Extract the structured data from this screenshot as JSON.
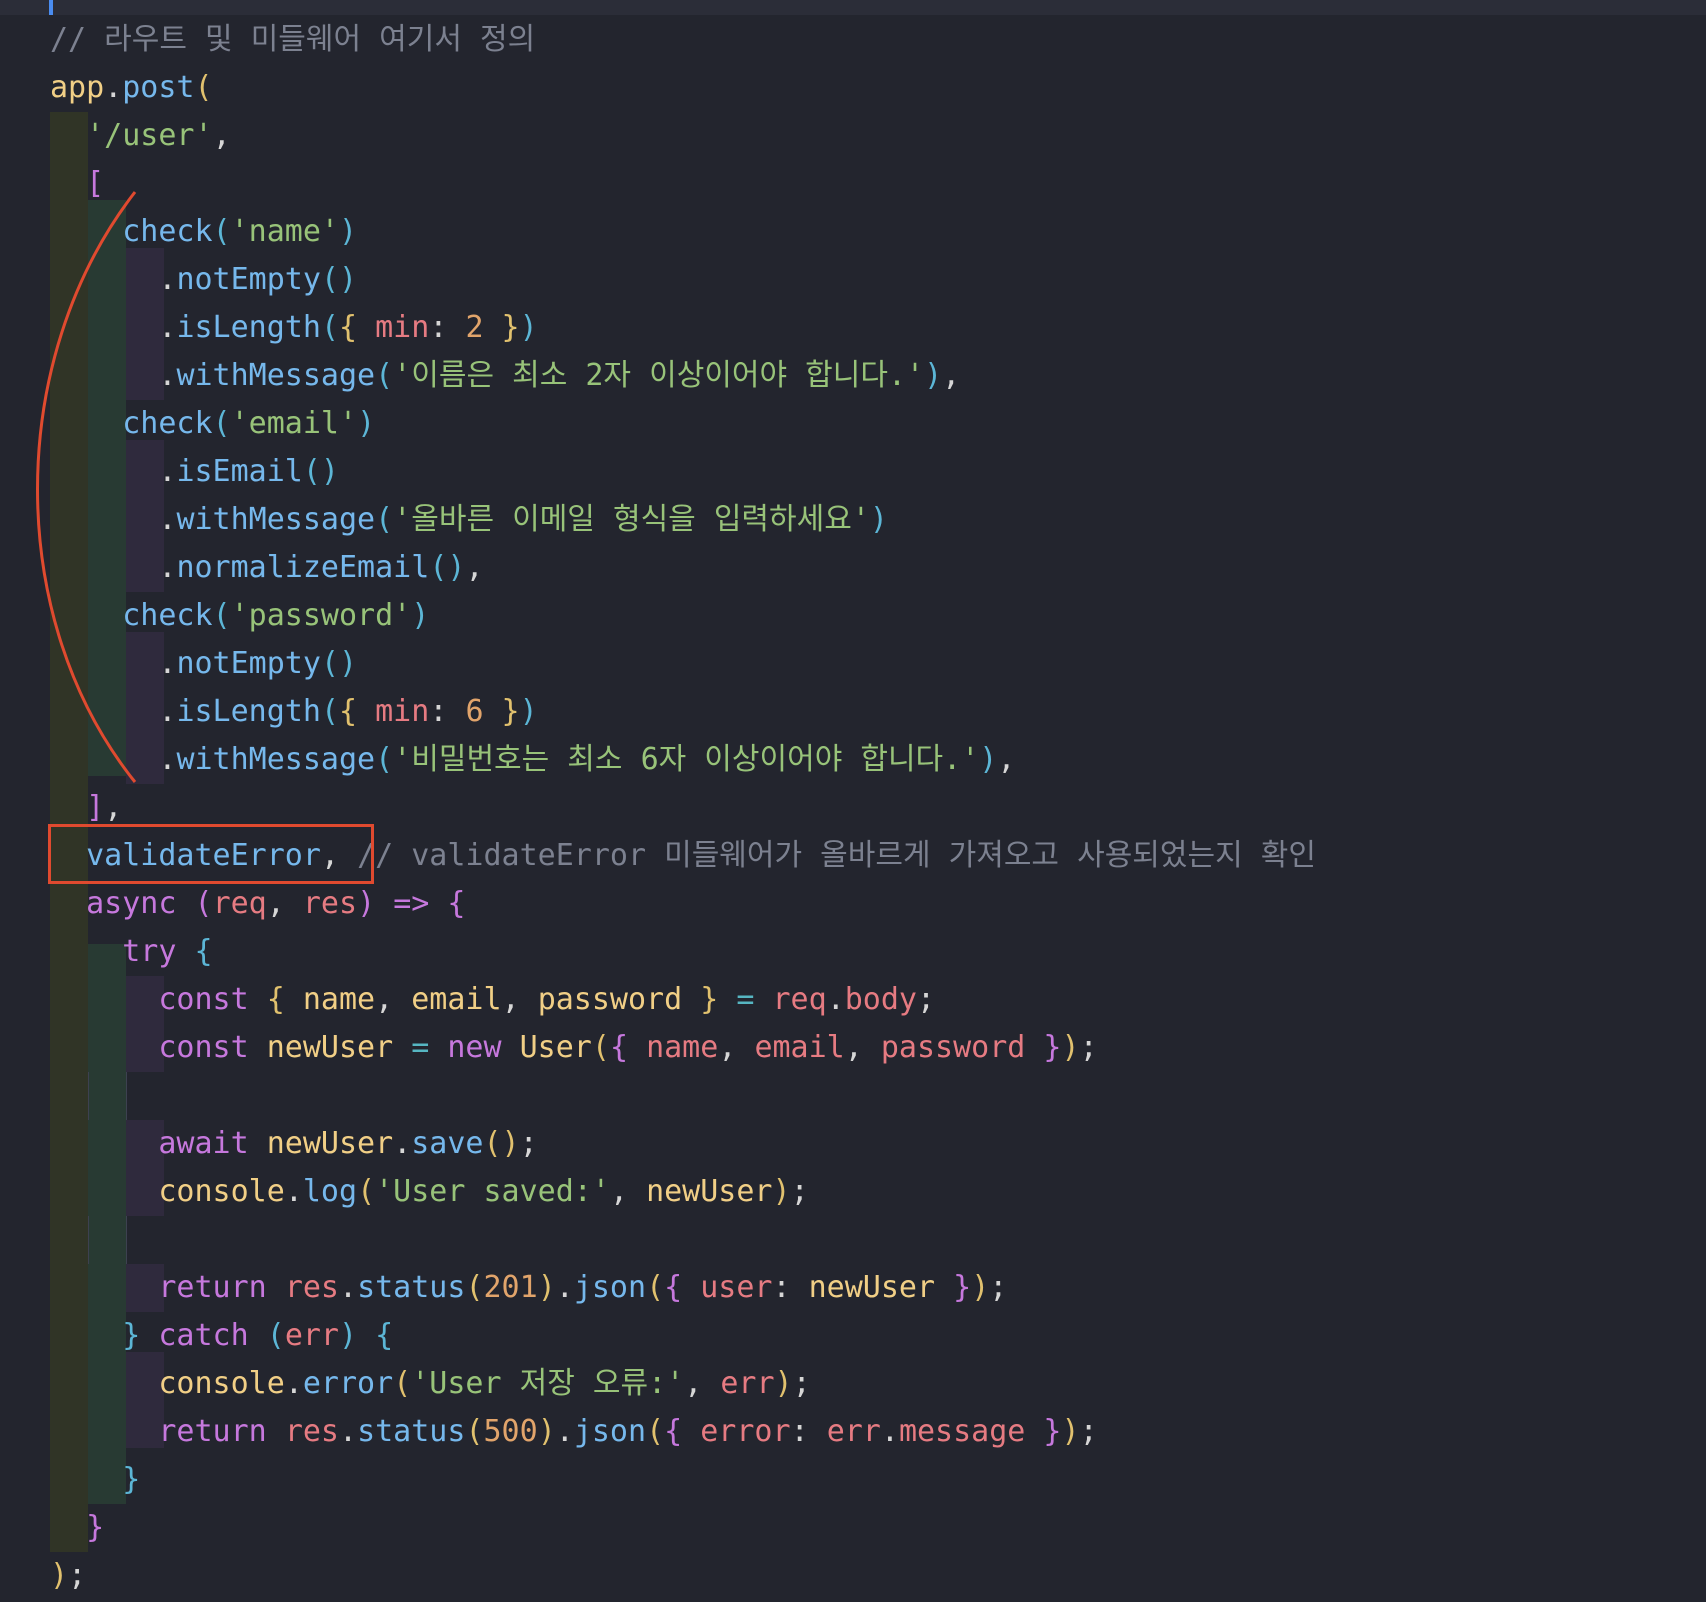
{
  "editor": {
    "lines": [
      [
        {
          "t": "// 라우트 및 미들웨어 여기서 정의",
          "c": "cm"
        }
      ],
      [
        {
          "t": "app",
          "c": "id"
        },
        {
          "t": ".",
          "c": "punc"
        },
        {
          "t": "post",
          "c": "fn"
        },
        {
          "t": "(",
          "c": "b1"
        }
      ],
      [
        {
          "t": "  ",
          "c": "punc"
        },
        {
          "t": "'/user'",
          "c": "str"
        },
        {
          "t": ",",
          "c": "punc"
        }
      ],
      [
        {
          "t": "  ",
          "c": "punc"
        },
        {
          "t": "[",
          "c": "b2"
        }
      ],
      [
        {
          "t": "    ",
          "c": "punc"
        },
        {
          "t": "check",
          "c": "fn"
        },
        {
          "t": "(",
          "c": "b3"
        },
        {
          "t": "'name'",
          "c": "str"
        },
        {
          "t": ")",
          "c": "b3"
        }
      ],
      [
        {
          "t": "      .",
          "c": "punc"
        },
        {
          "t": "notEmpty",
          "c": "fn"
        },
        {
          "t": "()",
          "c": "b3"
        }
      ],
      [
        {
          "t": "      .",
          "c": "punc"
        },
        {
          "t": "isLength",
          "c": "fn"
        },
        {
          "t": "(",
          "c": "b3"
        },
        {
          "t": "{ ",
          "c": "b1"
        },
        {
          "t": "min",
          "c": "var"
        },
        {
          "t": ": ",
          "c": "punc"
        },
        {
          "t": "2",
          "c": "num"
        },
        {
          "t": " }",
          "c": "b1"
        },
        {
          "t": ")",
          "c": "b3"
        }
      ],
      [
        {
          "t": "      .",
          "c": "punc"
        },
        {
          "t": "withMessage",
          "c": "fn"
        },
        {
          "t": "(",
          "c": "b3"
        },
        {
          "t": "'이름은 최소 2자 이상이어야 합니다.'",
          "c": "str"
        },
        {
          "t": ")",
          "c": "b3"
        },
        {
          "t": ",",
          "c": "punc"
        }
      ],
      [
        {
          "t": "    ",
          "c": "punc"
        },
        {
          "t": "check",
          "c": "fn"
        },
        {
          "t": "(",
          "c": "b3"
        },
        {
          "t": "'email'",
          "c": "str"
        },
        {
          "t": ")",
          "c": "b3"
        }
      ],
      [
        {
          "t": "      .",
          "c": "punc"
        },
        {
          "t": "isEmail",
          "c": "fn"
        },
        {
          "t": "()",
          "c": "b3"
        }
      ],
      [
        {
          "t": "      .",
          "c": "punc"
        },
        {
          "t": "withMessage",
          "c": "fn"
        },
        {
          "t": "(",
          "c": "b3"
        },
        {
          "t": "'올바른 이메일 형식을 입력하세요'",
          "c": "str"
        },
        {
          "t": ")",
          "c": "b3"
        }
      ],
      [
        {
          "t": "      .",
          "c": "punc"
        },
        {
          "t": "normalizeEmail",
          "c": "fn"
        },
        {
          "t": "()",
          "c": "b3"
        },
        {
          "t": ",",
          "c": "punc"
        }
      ],
      [
        {
          "t": "    ",
          "c": "punc"
        },
        {
          "t": "check",
          "c": "fn"
        },
        {
          "t": "(",
          "c": "b3"
        },
        {
          "t": "'password'",
          "c": "str"
        },
        {
          "t": ")",
          "c": "b3"
        }
      ],
      [
        {
          "t": "      .",
          "c": "punc"
        },
        {
          "t": "notEmpty",
          "c": "fn"
        },
        {
          "t": "()",
          "c": "b3"
        }
      ],
      [
        {
          "t": "      .",
          "c": "punc"
        },
        {
          "t": "isLength",
          "c": "fn"
        },
        {
          "t": "(",
          "c": "b3"
        },
        {
          "t": "{ ",
          "c": "b1"
        },
        {
          "t": "min",
          "c": "var"
        },
        {
          "t": ": ",
          "c": "punc"
        },
        {
          "t": "6",
          "c": "num"
        },
        {
          "t": " }",
          "c": "b1"
        },
        {
          "t": ")",
          "c": "b3"
        }
      ],
      [
        {
          "t": "      .",
          "c": "punc"
        },
        {
          "t": "withMessage",
          "c": "fn"
        },
        {
          "t": "(",
          "c": "b3"
        },
        {
          "t": "'비밀번호는 최소 6자 이상이어야 합니다.'",
          "c": "str"
        },
        {
          "t": ")",
          "c": "b3"
        },
        {
          "t": ",",
          "c": "punc"
        }
      ],
      [
        {
          "t": "  ",
          "c": "punc"
        },
        {
          "t": "]",
          "c": "b2"
        },
        {
          "t": ",",
          "c": "punc"
        }
      ],
      [
        {
          "t": "  ",
          "c": "punc"
        },
        {
          "t": "validateError",
          "c": "fn"
        },
        {
          "t": ", ",
          "c": "punc"
        },
        {
          "t": "// validateError 미들웨어가 올바르게 가져오고 사용되었는지 확인",
          "c": "cm"
        }
      ],
      [
        {
          "t": "  ",
          "c": "punc"
        },
        {
          "t": "async",
          "c": "kw"
        },
        {
          "t": " ",
          "c": "punc"
        },
        {
          "t": "(",
          "c": "b2"
        },
        {
          "t": "req",
          "c": "var"
        },
        {
          "t": ", ",
          "c": "punc"
        },
        {
          "t": "res",
          "c": "var"
        },
        {
          "t": ")",
          "c": "b2"
        },
        {
          "t": " ",
          "c": "punc"
        },
        {
          "t": "=>",
          "c": "kw"
        },
        {
          "t": " ",
          "c": "punc"
        },
        {
          "t": "{",
          "c": "b2"
        }
      ],
      [
        {
          "t": "    ",
          "c": "punc"
        },
        {
          "t": "try",
          "c": "kw"
        },
        {
          "t": " ",
          "c": "punc"
        },
        {
          "t": "{",
          "c": "b3"
        }
      ],
      [
        {
          "t": "      ",
          "c": "punc"
        },
        {
          "t": "const",
          "c": "kw"
        },
        {
          "t": " ",
          "c": "punc"
        },
        {
          "t": "{",
          "c": "b1"
        },
        {
          "t": " name",
          "c": "id"
        },
        {
          "t": ", ",
          "c": "punc"
        },
        {
          "t": "email",
          "c": "id"
        },
        {
          "t": ", ",
          "c": "punc"
        },
        {
          "t": "password",
          "c": "id"
        },
        {
          "t": " }",
          "c": "b1"
        },
        {
          "t": " = ",
          "c": "op"
        },
        {
          "t": "req",
          "c": "var"
        },
        {
          "t": ".",
          "c": "punc"
        },
        {
          "t": "body",
          "c": "var"
        },
        {
          "t": ";",
          "c": "punc"
        }
      ],
      [
        {
          "t": "      ",
          "c": "punc"
        },
        {
          "t": "const",
          "c": "kw"
        },
        {
          "t": " ",
          "c": "punc"
        },
        {
          "t": "newUser",
          "c": "id"
        },
        {
          "t": " = ",
          "c": "op"
        },
        {
          "t": "new",
          "c": "kw"
        },
        {
          "t": " ",
          "c": "punc"
        },
        {
          "t": "User",
          "c": "id"
        },
        {
          "t": "(",
          "c": "b1"
        },
        {
          "t": "{ ",
          "c": "b2"
        },
        {
          "t": "name",
          "c": "var"
        },
        {
          "t": ", ",
          "c": "punc"
        },
        {
          "t": "email",
          "c": "var"
        },
        {
          "t": ", ",
          "c": "punc"
        },
        {
          "t": "password",
          "c": "var"
        },
        {
          "t": " }",
          "c": "b2"
        },
        {
          "t": ")",
          "c": "b1"
        },
        {
          "t": ";",
          "c": "punc"
        }
      ],
      [
        {
          "t": "",
          "c": "punc"
        }
      ],
      [
        {
          "t": "      ",
          "c": "punc"
        },
        {
          "t": "await",
          "c": "kw"
        },
        {
          "t": " ",
          "c": "punc"
        },
        {
          "t": "newUser",
          "c": "id"
        },
        {
          "t": ".",
          "c": "punc"
        },
        {
          "t": "save",
          "c": "fn"
        },
        {
          "t": "()",
          "c": "b1"
        },
        {
          "t": ";",
          "c": "punc"
        }
      ],
      [
        {
          "t": "      ",
          "c": "punc"
        },
        {
          "t": "console",
          "c": "id"
        },
        {
          "t": ".",
          "c": "punc"
        },
        {
          "t": "log",
          "c": "fn"
        },
        {
          "t": "(",
          "c": "b1"
        },
        {
          "t": "'User saved:'",
          "c": "str"
        },
        {
          "t": ", ",
          "c": "punc"
        },
        {
          "t": "newUser",
          "c": "id"
        },
        {
          "t": ")",
          "c": "b1"
        },
        {
          "t": ";",
          "c": "punc"
        }
      ],
      [
        {
          "t": "",
          "c": "punc"
        }
      ],
      [
        {
          "t": "      ",
          "c": "punc"
        },
        {
          "t": "return",
          "c": "kw"
        },
        {
          "t": " ",
          "c": "punc"
        },
        {
          "t": "res",
          "c": "var"
        },
        {
          "t": ".",
          "c": "punc"
        },
        {
          "t": "status",
          "c": "fn"
        },
        {
          "t": "(",
          "c": "b1"
        },
        {
          "t": "201",
          "c": "num"
        },
        {
          "t": ")",
          "c": "b1"
        },
        {
          "t": ".",
          "c": "punc"
        },
        {
          "t": "json",
          "c": "fn"
        },
        {
          "t": "(",
          "c": "b1"
        },
        {
          "t": "{ ",
          "c": "b2"
        },
        {
          "t": "user",
          "c": "var"
        },
        {
          "t": ": ",
          "c": "punc"
        },
        {
          "t": "newUser",
          "c": "id"
        },
        {
          "t": " }",
          "c": "b2"
        },
        {
          "t": ")",
          "c": "b1"
        },
        {
          "t": ";",
          "c": "punc"
        }
      ],
      [
        {
          "t": "    ",
          "c": "punc"
        },
        {
          "t": "}",
          "c": "b3"
        },
        {
          "t": " ",
          "c": "punc"
        },
        {
          "t": "catch",
          "c": "kw"
        },
        {
          "t": " ",
          "c": "punc"
        },
        {
          "t": "(",
          "c": "b3"
        },
        {
          "t": "err",
          "c": "var"
        },
        {
          "t": ")",
          "c": "b3"
        },
        {
          "t": " ",
          "c": "punc"
        },
        {
          "t": "{",
          "c": "b3"
        }
      ],
      [
        {
          "t": "      ",
          "c": "punc"
        },
        {
          "t": "console",
          "c": "id"
        },
        {
          "t": ".",
          "c": "punc"
        },
        {
          "t": "error",
          "c": "fn"
        },
        {
          "t": "(",
          "c": "b1"
        },
        {
          "t": "'User 저장 오류:'",
          "c": "str"
        },
        {
          "t": ", ",
          "c": "punc"
        },
        {
          "t": "err",
          "c": "var"
        },
        {
          "t": ")",
          "c": "b1"
        },
        {
          "t": ";",
          "c": "punc"
        }
      ],
      [
        {
          "t": "      ",
          "c": "punc"
        },
        {
          "t": "return",
          "c": "kw"
        },
        {
          "t": " ",
          "c": "punc"
        },
        {
          "t": "res",
          "c": "var"
        },
        {
          "t": ".",
          "c": "punc"
        },
        {
          "t": "status",
          "c": "fn"
        },
        {
          "t": "(",
          "c": "b1"
        },
        {
          "t": "500",
          "c": "num"
        },
        {
          "t": ")",
          "c": "b1"
        },
        {
          "t": ".",
          "c": "punc"
        },
        {
          "t": "json",
          "c": "fn"
        },
        {
          "t": "(",
          "c": "b1"
        },
        {
          "t": "{ ",
          "c": "b2"
        },
        {
          "t": "error",
          "c": "var"
        },
        {
          "t": ": ",
          "c": "punc"
        },
        {
          "t": "err",
          "c": "var"
        },
        {
          "t": ".",
          "c": "punc"
        },
        {
          "t": "message",
          "c": "var"
        },
        {
          "t": " }",
          "c": "b2"
        },
        {
          "t": ")",
          "c": "b1"
        },
        {
          "t": ";",
          "c": "punc"
        }
      ],
      [
        {
          "t": "    ",
          "c": "punc"
        },
        {
          "t": "}",
          "c": "b3"
        }
      ],
      [
        {
          "t": "  ",
          "c": "punc"
        },
        {
          "t": "}",
          "c": "b2"
        }
      ],
      [
        {
          "t": ")",
          "c": "b1"
        },
        {
          "t": ";",
          "c": "punc"
        }
      ]
    ]
  },
  "colors": {
    "background": "#23252e",
    "annotation": "#e04a2f",
    "cursor": "#4a8cf0"
  }
}
